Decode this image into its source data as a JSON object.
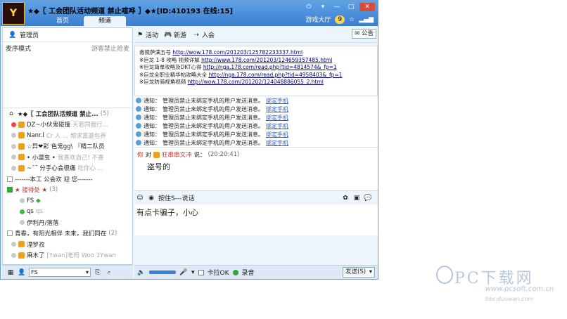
{
  "title": "★◆〖 工会团队活动频道 禁止喧哗 〗◆★[ID:410193 在线:15]",
  "tabs": [
    "首页",
    "频道"
  ],
  "top_right": {
    "game_hall": "游戏大厅",
    "count": "9"
  },
  "left": {
    "admin_label": "管理员",
    "mode_label": "麦序模式",
    "mode_right": "游客禁止抢麦",
    "tree": [
      {
        "text": "★◆〖 工会团队活频道 禁止...",
        "extra": "(5)"
      },
      {
        "text": "DZ~小伙鬼碰撞",
        "extra": "天若同我行..."
      },
      {
        "text": "Nanr.l",
        "extra": "Cr 人 ... 频求富婆包养"
      },
      {
        "text": "☆异❤彩",
        "extra": "色鬼gg\\ 『精二队员"
      },
      {
        "text": "• 小澀虫 •",
        "extra": "我喜欢自己! 不喜"
      },
      {
        "text": "~ˉ˜ 分手心会很痛",
        "extra": "吃你心 ..."
      },
      {
        "text": "-------本工 公会欢 迎 您-------",
        "extra": ""
      },
      {
        "text": "★ 接待处 ★",
        "extra": "(3)"
      },
      {
        "text": "FS",
        "extra": ""
      },
      {
        "text": "qs",
        "extra": "qs"
      },
      {
        "text": "伊利丹/落落",
        "extra": ""
      },
      {
        "text": "青春，有阳光相伴 未来，我们同在",
        "extra": "(2)"
      },
      {
        "text": "湮罗孜",
        "extra": ""
      },
      {
        "text": "麻木了",
        "extra": "[Ywan]老吗 Woo 1Ywan"
      }
    ],
    "bottom_combo": "FS"
  },
  "toolbar": {
    "activity": "活动",
    "new_tour": "新游",
    "join": "入会",
    "announcement": "公告"
  },
  "notice_lines": [
    {
      "label": "救赎萨满五号",
      "url": "http://wow.178.com/201203/125782233337.html"
    },
    {
      "label": "※巨龙 1-8 攻略 视频详解",
      "url": "http://www.178.com/201203/124659357485.html"
    },
    {
      "label": "※巨龙简单攻略及DKT心得",
      "url": "http://nga.178.com/read.php?tid=4814574&_fp=1"
    },
    {
      "label": "※巨龙全职业精华帖攻略大全",
      "url": "http://nga.178.com/read.php?tid=4958403&_fp=1"
    },
    {
      "label": "※巨龙防骑视角视频",
      "url": "http://wow.178.com/201202/124048886055_2.html"
    }
  ],
  "messages": [
    {
      "prefix": "通知：",
      "text": "管理员禁止未绑定手机的用户发送消息。",
      "link": "绑定手机"
    },
    {
      "prefix": "通知：",
      "text": "管理员禁止未绑定手机的用户发送消息。",
      "link": "绑定手机"
    },
    {
      "prefix": "通知：",
      "text": "管理员禁止未绑定手机的用户发送消息。",
      "link": "绑定手机"
    },
    {
      "prefix": "通知：",
      "text": "管理员禁止未绑定手机的用户发送消息。",
      "link": "绑定手机"
    },
    {
      "prefix": "通知：",
      "text": "管理员禁止未绑定手机的用户发送消息。",
      "link": "绑定手机"
    },
    {
      "prefix": "通知：",
      "text": "管理员禁止未绑定手机的用户发送消息。",
      "link": "绑定手机"
    }
  ],
  "chat": {
    "you": "你",
    "to": "对",
    "target": "狂串串文冲",
    "says": "说：",
    "time": "(20:20:41)",
    "text": "盗号的"
  },
  "input": {
    "mode": "按住S---说话",
    "text": "有点卡骗子，小心"
  },
  "bottom": {
    "kala": "卡拉OK",
    "record": "录音",
    "send": "发送(S)"
  },
  "watermark": {
    "main": "PC下载网",
    "url": "www.pcsoft.com.cn",
    "sub": "bbs.duowan.com"
  }
}
